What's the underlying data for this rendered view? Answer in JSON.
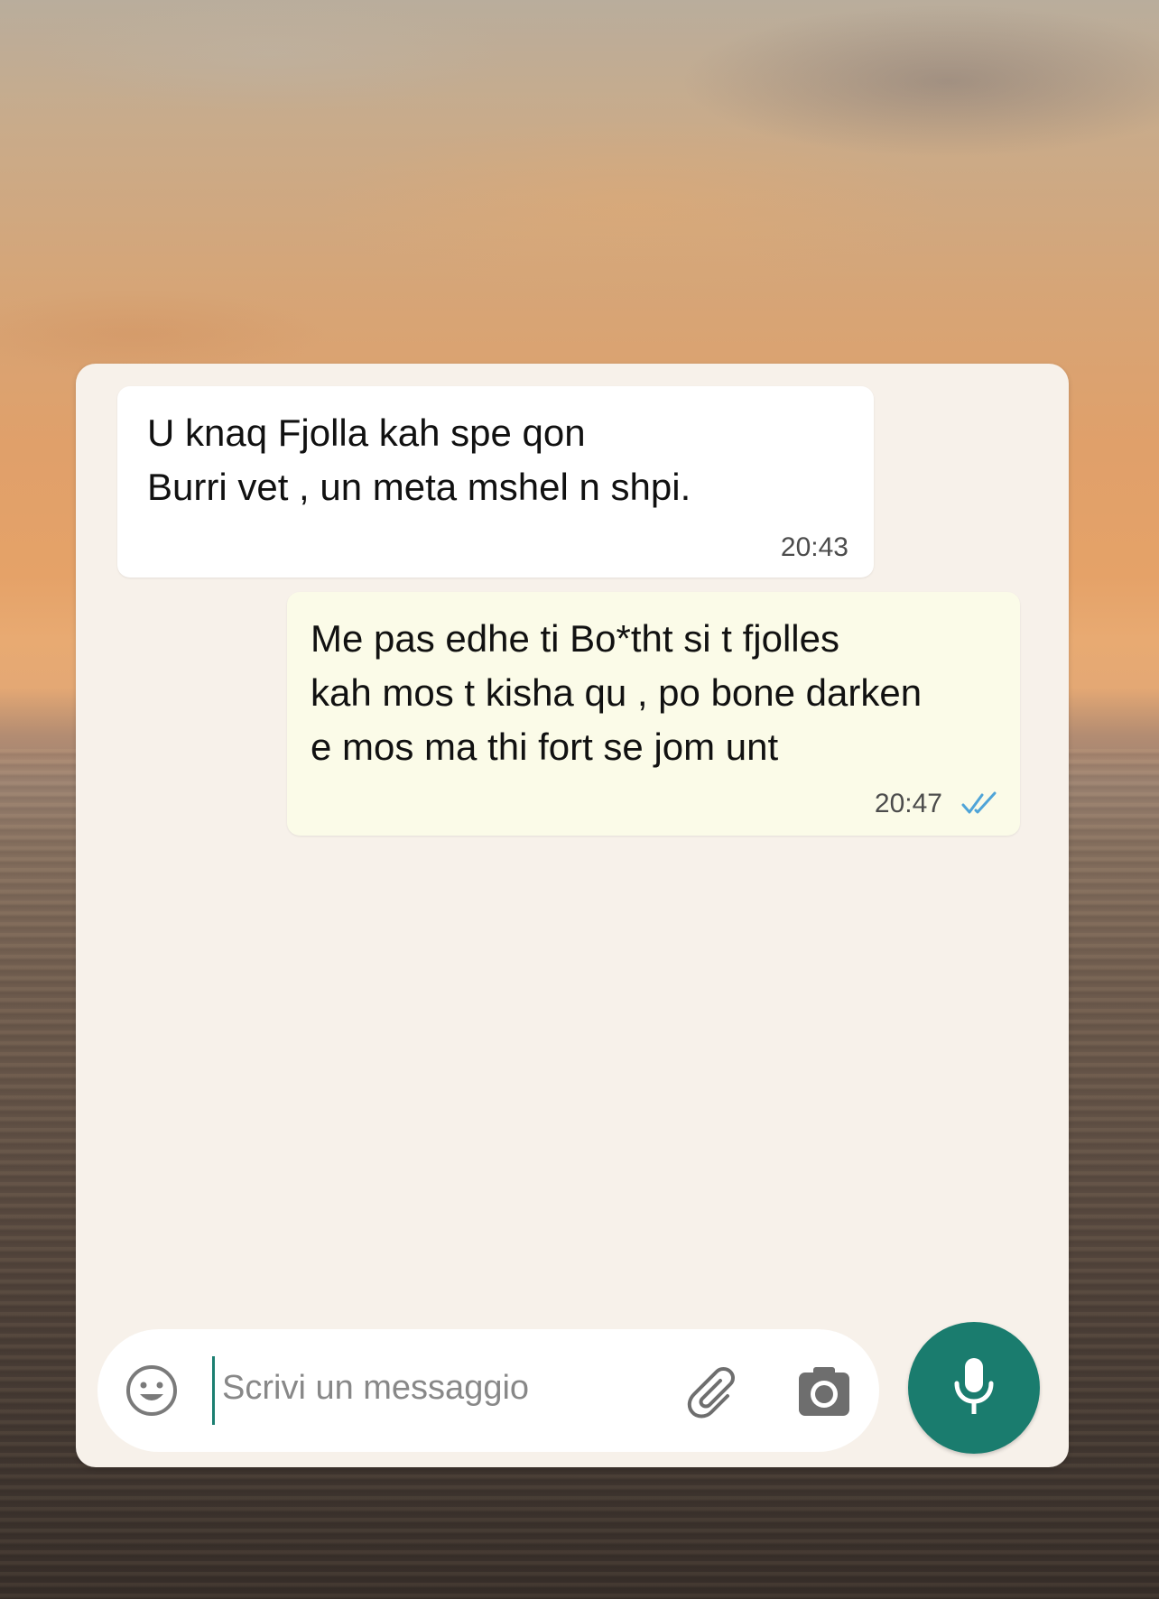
{
  "colors": {
    "panel_background": "#f7f1ea",
    "incoming_bubble": "#ffffff",
    "outgoing_bubble": "#fbfbe8",
    "accent": "#1a7c6e",
    "read_ticks": "#4fa4d8"
  },
  "messages": [
    {
      "direction": "incoming",
      "text": "U knaq Fjolla kah spe qon\nBurri vet , un meta mshel n shpi.",
      "time": "20:43"
    },
    {
      "direction": "outgoing",
      "text": "Me pas edhe ti Bo*tht si t fjolles\nkah mos t kisha qu , po bone darken\ne mos ma thi fort se jom unt",
      "time": "20:47",
      "status_icon": "double-check-icon"
    }
  ],
  "composer": {
    "placeholder": "Scrivi un messaggio",
    "value": "",
    "emoji_icon": "emoji-icon",
    "attach_icon": "paperclip-icon",
    "camera_icon": "camera-icon",
    "send_icon": "microphone-icon"
  }
}
